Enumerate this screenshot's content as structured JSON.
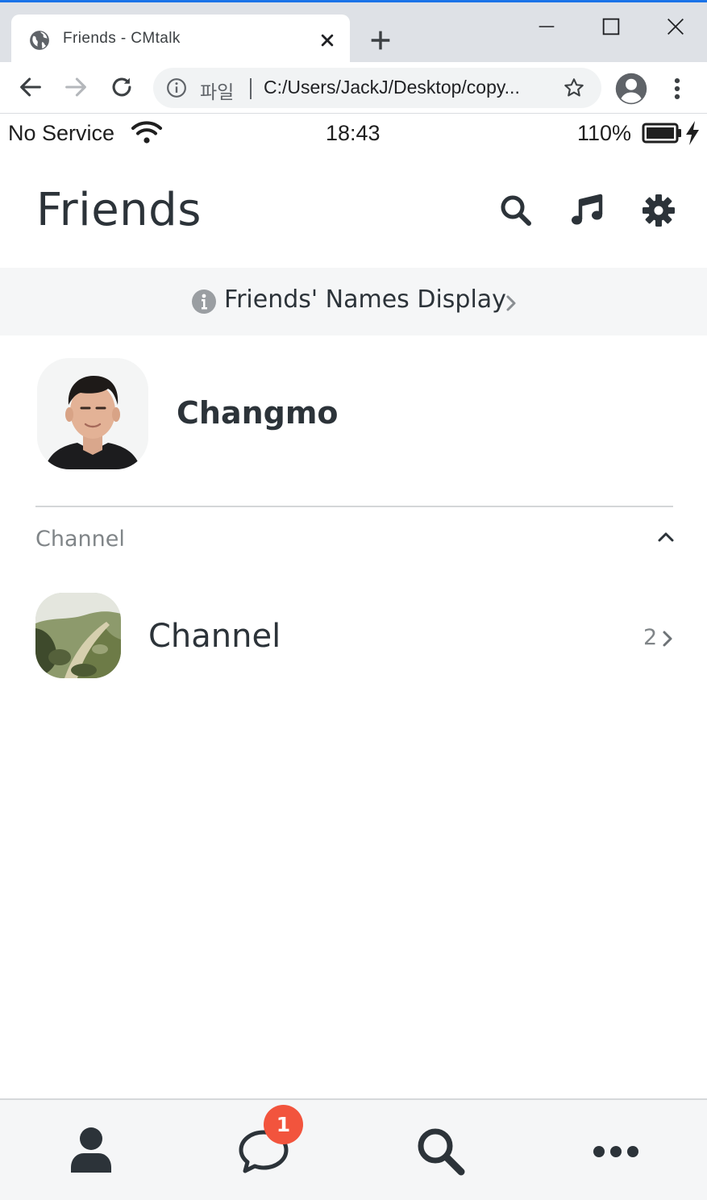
{
  "browser": {
    "tab_title": "Friends - CMtalk",
    "tab_icon": "globe-icon",
    "address_scheme": "파일",
    "address_url": "C:/Users/JackJ/Desktop/copy...",
    "accent_color": "#1a73e8"
  },
  "status_bar": {
    "carrier": "No Service",
    "time": "18:43",
    "battery": "110%"
  },
  "header": {
    "title": "Friends",
    "actions": [
      "search-icon",
      "music-icon",
      "gear-icon"
    ]
  },
  "info_bar": {
    "text": "Friends' Names Display"
  },
  "profile": {
    "name": "Changmo"
  },
  "channel_section": {
    "label": "Channel",
    "items": [
      {
        "name": "Channel",
        "count": "2"
      }
    ]
  },
  "tab_bar": {
    "items": [
      "person-icon",
      "chat-icon",
      "search-icon",
      "more-icon"
    ],
    "chat_badge": "1",
    "badge_color": "#f2543d"
  }
}
